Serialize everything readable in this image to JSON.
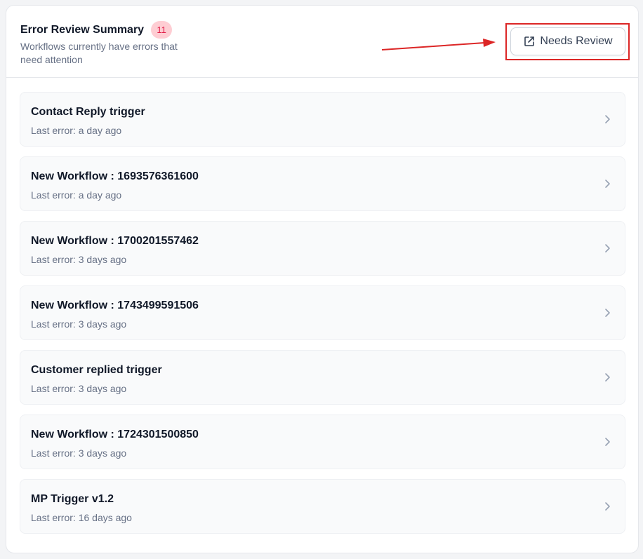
{
  "header": {
    "title": "Error Review Summary",
    "badge_count": "11",
    "subtitle": "Workflows currently have errors that need attention",
    "button_label": "Needs Review",
    "button_icon": "external-link-icon"
  },
  "annotation_color": "#dc2626",
  "badge_colors": {
    "bg": "#fecdd3",
    "text": "#e11d48"
  },
  "workflows": [
    {
      "name": "Contact Reply trigger",
      "last_error": "Last error: a day ago"
    },
    {
      "name": "New Workflow : 1693576361600",
      "last_error": "Last error: a day ago"
    },
    {
      "name": "New Workflow : 1700201557462",
      "last_error": "Last error: 3 days ago"
    },
    {
      "name": "New Workflow : 1743499591506",
      "last_error": "Last error: 3 days ago"
    },
    {
      "name": "Customer replied trigger",
      "last_error": "Last error: 3 days ago"
    },
    {
      "name": "New Workflow : 1724301500850",
      "last_error": "Last error: 3 days ago"
    },
    {
      "name": "MP Trigger v1.2",
      "last_error": "Last error: 16 days ago"
    }
  ]
}
